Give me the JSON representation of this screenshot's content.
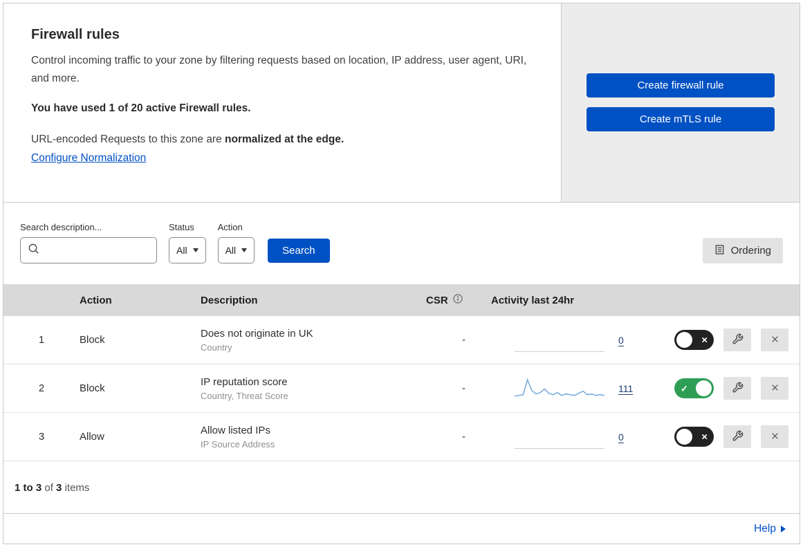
{
  "header": {
    "title": "Firewall rules",
    "description": "Control incoming traffic to your zone by filtering requests based on location, IP address, user agent, URI, and more.",
    "usage": "You have used 1 of 20 active Firewall rules.",
    "norm_text": "URL-encoded Requests to this zone are ",
    "norm_bold": "normalized at the edge.",
    "norm_link": "Configure Normalization",
    "create_firewall_button": "Create firewall rule",
    "create_mtls_button": "Create mTLS rule"
  },
  "filters": {
    "search_label": "Search description...",
    "search_value": "",
    "status_label": "Status",
    "status_value": "All",
    "action_label": "Action",
    "action_value": "All",
    "search_button": "Search",
    "ordering_button": "Ordering"
  },
  "table": {
    "columns": {
      "action": "Action",
      "description": "Description",
      "csr": "CSR",
      "activity": "Activity last 24hr"
    },
    "rows": [
      {
        "index": "1",
        "action": "Block",
        "description": "Does not originate in UK",
        "fields": "Country",
        "csr": "-",
        "activity_count": "0",
        "enabled": false,
        "has_sparkline": false
      },
      {
        "index": "2",
        "action": "Block",
        "description": "IP reputation score",
        "fields": "Country, Threat Score",
        "csr": "-",
        "activity_count": "111",
        "enabled": true,
        "has_sparkline": true
      },
      {
        "index": "3",
        "action": "Allow",
        "description": "Allow listed IPs",
        "fields": "IP Source Address",
        "csr": "-",
        "activity_count": "0",
        "enabled": false,
        "has_sparkline": false
      }
    ]
  },
  "footer": {
    "range": "1 to 3",
    "of": "of",
    "total": "3",
    "items": "items"
  },
  "help": {
    "label": "Help"
  },
  "sparkline": {
    "points": [
      4,
      5,
      6,
      27,
      12,
      7,
      9,
      14,
      8,
      6,
      9,
      5,
      7,
      6,
      5,
      8,
      11,
      6,
      7,
      5,
      6,
      5
    ]
  },
  "colors": {
    "primary": "#0051c3",
    "link": "#0051c3",
    "toggle_on": "#2f9e55",
    "toggle_off": "#222222",
    "sparkline": "#74a9dd",
    "table_header_bg": "#d9d9d9",
    "side_panel_bg": "#ececec"
  }
}
